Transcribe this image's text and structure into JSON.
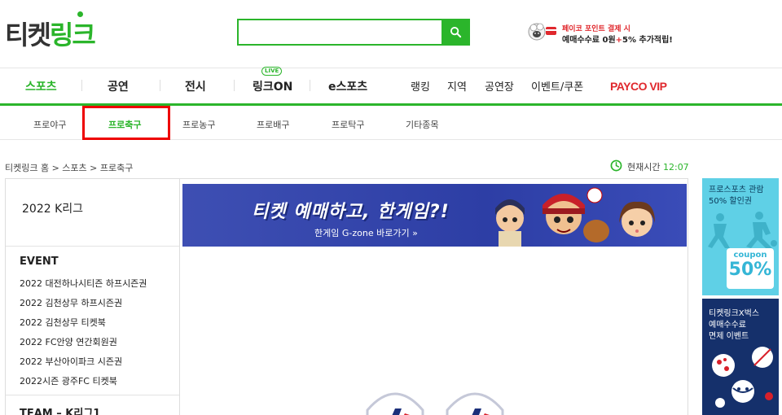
{
  "header": {
    "logo_text_1": "티켓",
    "logo_text_2": "링크",
    "search_value": "",
    "promo": {
      "line1": "페이코 포인트 결제 시",
      "line2_a": "예매수수료 0원",
      "line2_plus": "+",
      "line2_b": "5% 추가적립!"
    }
  },
  "main_nav": {
    "items": [
      "스포츠",
      "공연",
      "전시",
      "링크ON",
      "e스포츠"
    ],
    "live_badge": "LIVE",
    "sub_items": [
      "랭킹",
      "지역",
      "공연장",
      "이벤트/쿠폰"
    ],
    "payco": "PAYCO VIP"
  },
  "sub_nav": {
    "items": [
      "프로야구",
      "프로축구",
      "프로농구",
      "프로배구",
      "프로탁구",
      "기타종목"
    ]
  },
  "breadcrumb": "티켓링크 홈 > 스포츠 > 프로축구",
  "current_time": {
    "label": "현재시간",
    "value": "12:07"
  },
  "left_panel": {
    "title": "2022 K리그",
    "event_heading": "EVENT",
    "events": [
      "2022 대전하나시티즌 하프시즌권",
      "2022 김천상무 하프시즌권",
      "2022 김천상무 티켓북",
      "2022 FC안양 연간회원권",
      "2022 부산아이파크 시즌권",
      "2022시즌 광주FC 티켓북"
    ],
    "team_heading": "TEAM – K리그1"
  },
  "banner": {
    "title": "티켓 예매하고, 한게임?!",
    "subtitle": "한게임 G-zone 바로가기 »"
  },
  "ads": {
    "ad1": {
      "line1": "프로스포츠 관람",
      "line2": "50% 할인권",
      "coupon_word": "coupon",
      "coupon_value": "50%"
    },
    "ad2": {
      "line1": "티켓링크X벅스",
      "line2": "예매수수료",
      "line3": "면제 이벤트"
    }
  },
  "colors": {
    "brand_green": "#2bb52b",
    "payco_red": "#e0282d",
    "highlight_red": "#ee0000"
  }
}
